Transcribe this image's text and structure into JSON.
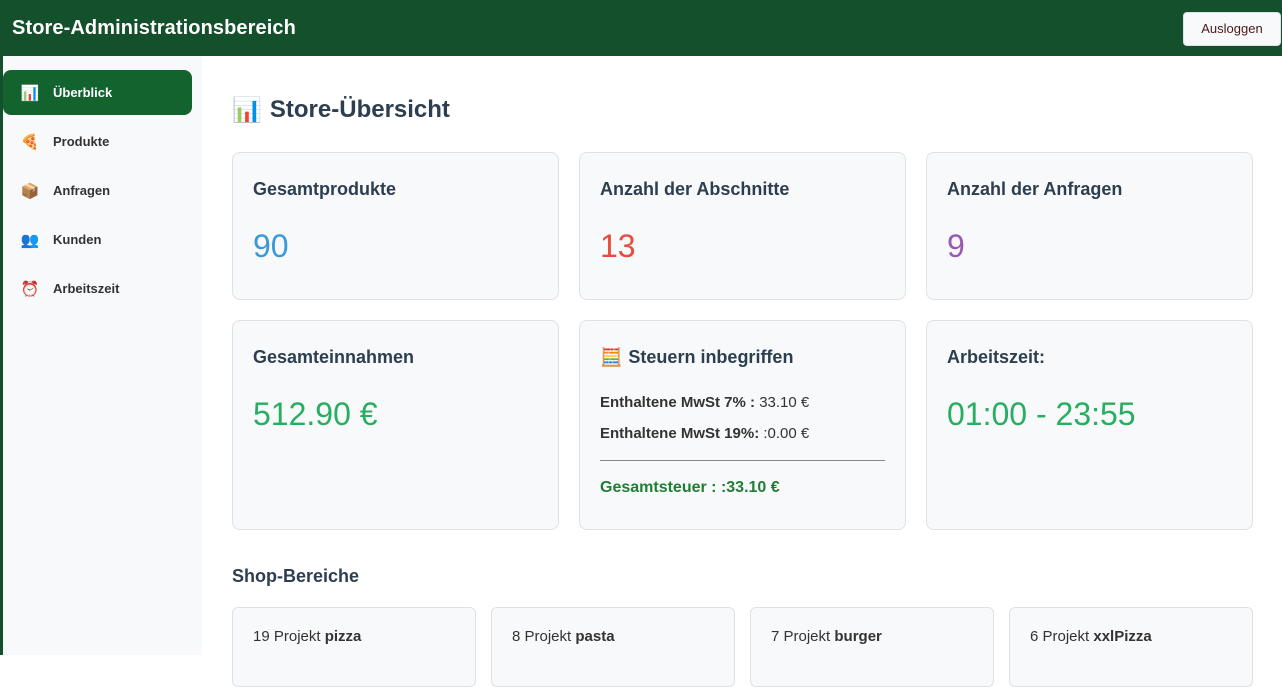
{
  "header": {
    "title": "Store-Administrationsbereich",
    "logout_label": "Ausloggen"
  },
  "sidebar": {
    "items": [
      {
        "label": "Überblick",
        "icon": "bar-chart-icon",
        "glyph": "📊",
        "active": true
      },
      {
        "label": "Produkte",
        "icon": "pizza-icon",
        "glyph": "🍕",
        "active": false
      },
      {
        "label": "Anfragen",
        "icon": "package-icon",
        "glyph": "📦",
        "active": false
      },
      {
        "label": "Kunden",
        "icon": "users-icon",
        "glyph": "👥",
        "active": false
      },
      {
        "label": "Arbeitszeit",
        "icon": "alarm-clock-icon",
        "glyph": "⏰",
        "active": false
      }
    ]
  },
  "main": {
    "title_icon": "📊",
    "title": "Store-Übersicht",
    "cards": {
      "total_products": {
        "label": "Gesamtprodukte",
        "value": "90",
        "color": "#3a9ad9"
      },
      "sections": {
        "label": "Anzahl der Abschnitte",
        "value": "13",
        "color": "#e74c3c"
      },
      "requests": {
        "label": "Anzahl der Anfragen",
        "value": "9",
        "color": "#9b59b6"
      },
      "revenue": {
        "label": "Gesamteinnahmen",
        "value": "512.90 €",
        "color": "#27ae60"
      },
      "tax": {
        "icon": "🧮",
        "label": "Steuern inbegriffen",
        "vat7_label": "Enthaltene MwSt 7% :",
        "vat7_value": " 33.10 €",
        "vat19_label": "Enthaltene MwSt 19%:",
        "vat19_value": " :0.00 €",
        "total_label": "Gesamtsteuer : :33.10 €"
      },
      "hours": {
        "label": "Arbeitszeit:",
        "value": "01:00 - 23:55",
        "color": "#27ae60"
      }
    },
    "shop_section_title": "Shop-Bereiche",
    "shops": [
      {
        "prefix": "19 Projekt ",
        "name": "pizza"
      },
      {
        "prefix": "8 Projekt ",
        "name": "pasta"
      },
      {
        "prefix": "7 Projekt ",
        "name": "burger"
      },
      {
        "prefix": "6 Projekt ",
        "name": "xxlPizza"
      }
    ]
  }
}
